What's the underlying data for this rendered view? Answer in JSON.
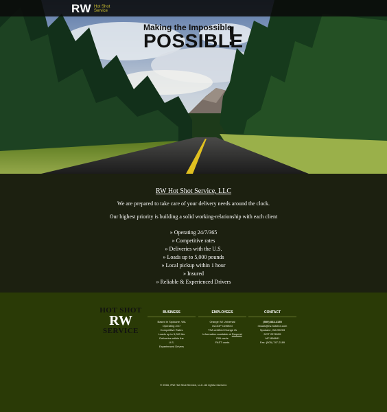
{
  "header": {
    "logo_main": "RW",
    "logo_sub_line1": "Hot Shot",
    "logo_sub_line2": "Service"
  },
  "hero": {
    "headline_small": "Making the Impossible",
    "headline_big": "POSSIBLE",
    "headline_bang": "!"
  },
  "info": {
    "title": "RW Hot Shot Service, LLC",
    "line1": "We are prepared to take care of your delivery needs around the clock.",
    "line2": "Our highest priority is building a solid working-relationship with each client",
    "features": [
      "» Operating 24/7/365",
      "» Competitive rates",
      "» Deliveries with the U.S.",
      "» Loads up to 5,000 pounds",
      "» Local pickup within 1 hour",
      "» Insured",
      "» Reliable & Experienced Drivers"
    ]
  },
  "footer": {
    "logo_top": "HOT SHOT",
    "logo_mid": "RW",
    "logo_bottom": "SERVICE",
    "business": {
      "heading": "BUSINESS",
      "lines": [
        "Based in Spokane, WA",
        "Operating 24/7",
        "Competitive Rates",
        "Loads up to 5,000 lbs",
        "Deliveries within the",
        "U.S.",
        "Experienced Drivers"
      ]
    },
    "employees": {
      "heading": "EMPLOYEES",
      "lines": [
        "Orange WI Universal",
        "IACIOP Certified",
        "TSA certified Orange IA",
        "Information available at",
        "EIN cards",
        "FAST cards"
      ],
      "link_text": "Request"
    },
    "contact": {
      "heading": "CONTACT",
      "phone": "(509) 863-2155",
      "lines": [
        "rwsaw@rw-hotshot.com",
        "Spokane, WA 99203",
        "DOT 2378155",
        "MC 866841",
        "Fax: (509) 747-2189"
      ]
    },
    "copyright": "© 2016, RW Hot Shot Service, LLC. All rights reserved."
  }
}
